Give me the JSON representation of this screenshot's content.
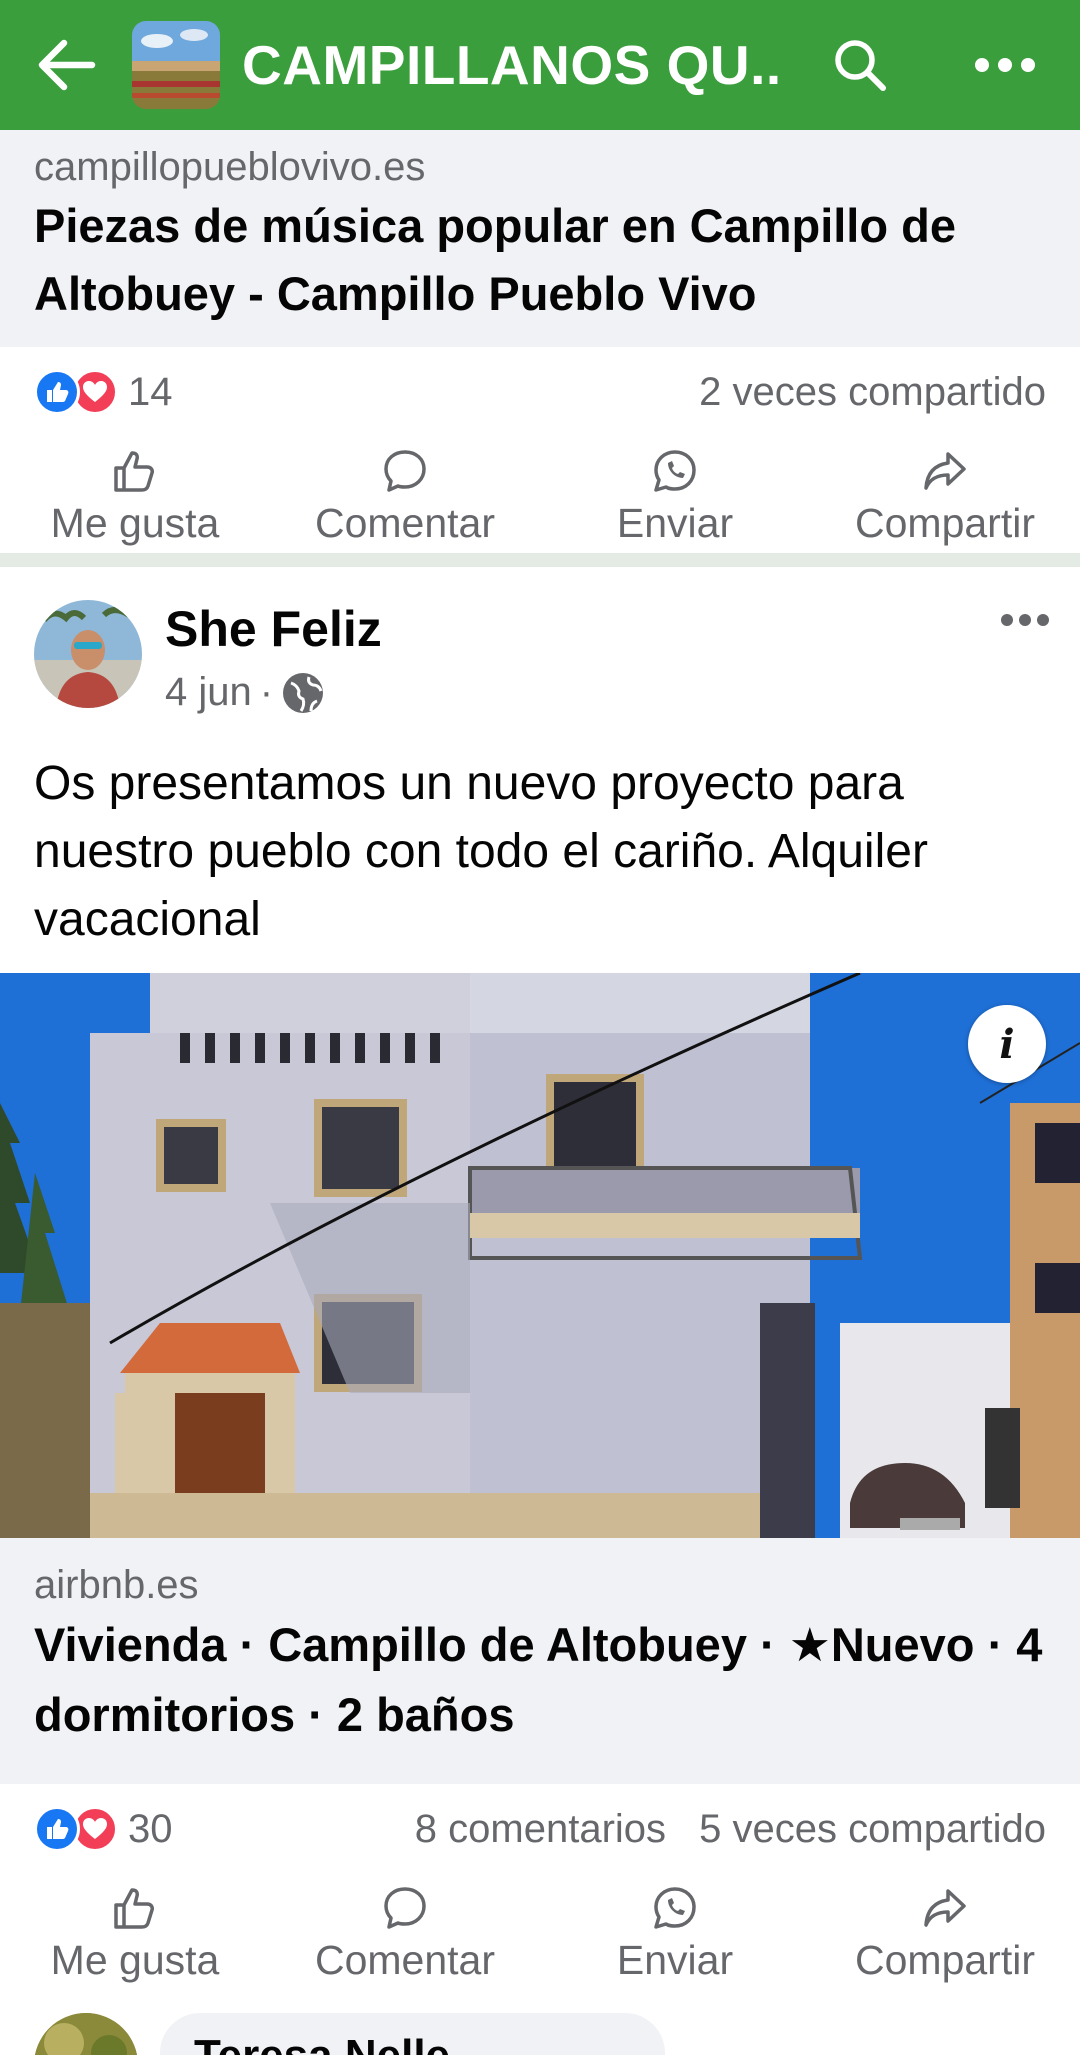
{
  "topbar": {
    "group_title": "CAMPILLANOS QU...",
    "back_icon": "arrow-left-icon",
    "search_icon": "search-icon",
    "more_icon": "more-horizontal-icon",
    "bar_color": "#3b9e3d"
  },
  "post1": {
    "link_domain": "campillopueblovivo.es",
    "link_title": "Piezas de música popular en Campillo de Altobuey - Campillo Pueblo Vivo",
    "reaction_count": "14",
    "shares": "2 veces compartido"
  },
  "actions": {
    "like": "Me gusta",
    "comment": "Comentar",
    "send": "Enviar",
    "share": "Compartir"
  },
  "post2": {
    "author": "She Feliz",
    "date": "4 jun",
    "separator": "·",
    "text": "Os presentamos un nuevo proyecto para nuestro pueblo con todo el cariño. Alquiler vacacional",
    "info_label": "i",
    "link_domain": "airbnb.es",
    "link_title": "Vivienda · Campillo de Altobuey · ★Nuevo · 4 dormitorios · 2 baños",
    "reaction_count": "30",
    "comments": "8 comentarios",
    "shares": "5 veces compartido"
  },
  "comment": {
    "author": "Teresa Nelle"
  },
  "colors": {
    "like_blue": "#1877f2",
    "love_red": "#f33e58",
    "secondary_text": "#65676b",
    "preview_bg": "#f0f2f5"
  }
}
